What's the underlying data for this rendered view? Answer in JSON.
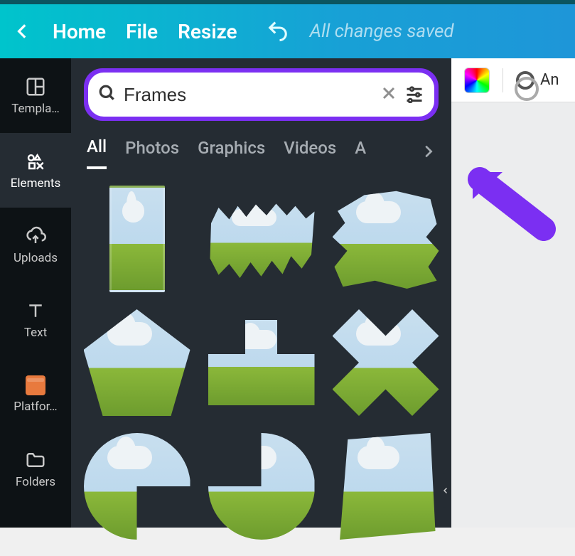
{
  "topbar": {
    "home": "Home",
    "file": "File",
    "resize": "Resize",
    "status": "All changes saved"
  },
  "rail": {
    "templates": "Templa…",
    "elements": "Elements",
    "uploads": "Uploads",
    "text": "Text",
    "platform": "Platfor…",
    "folders": "Folders"
  },
  "search": {
    "value": "Frames"
  },
  "tabs": {
    "all": "All",
    "photos": "Photos",
    "graphics": "Graphics",
    "videos": "Videos",
    "audio_partial": "A"
  },
  "context": {
    "animate": "An"
  }
}
